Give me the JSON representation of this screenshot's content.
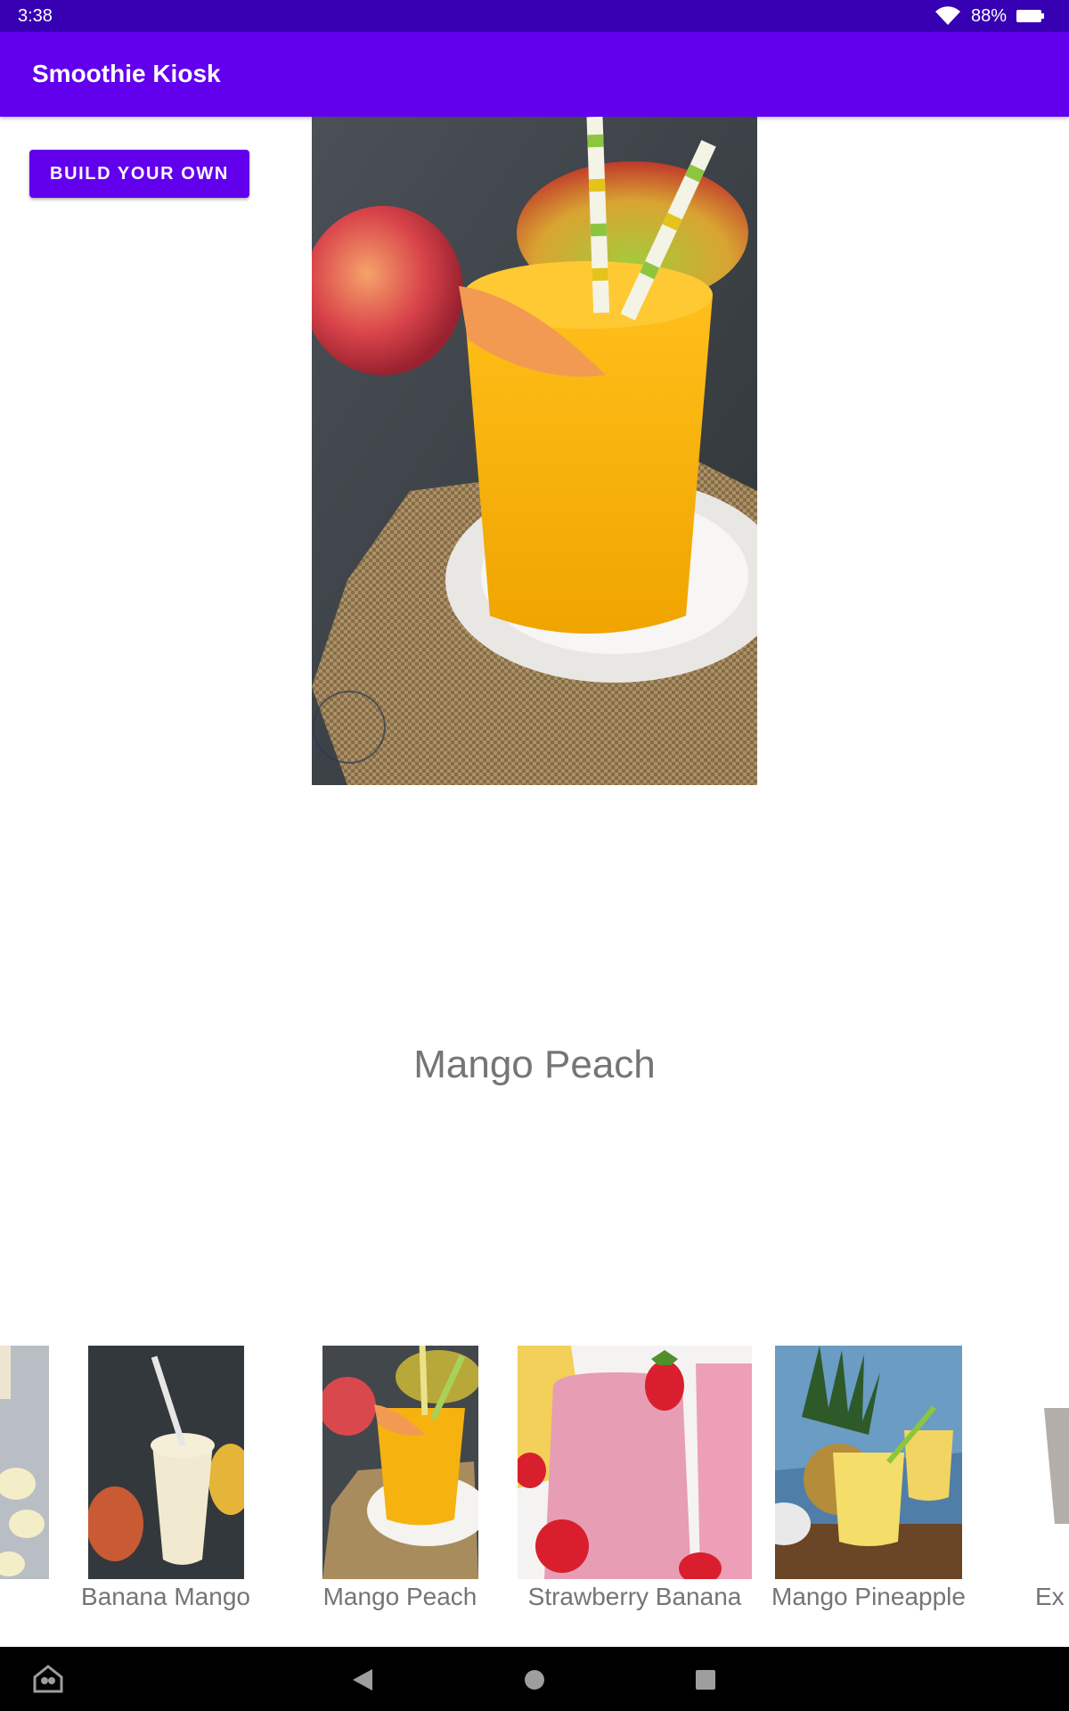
{
  "status_bar": {
    "time": "3:38",
    "battery": "88%"
  },
  "app_bar": {
    "title": "Smoothie Kiosk"
  },
  "build_button": {
    "label": "BUILD YOUR OWN"
  },
  "selected": {
    "name": "Mango Peach"
  },
  "carousel": {
    "items": [
      {
        "label": "Banana Mango"
      },
      {
        "label": "Mango Peach"
      },
      {
        "label": "Strawberry Banana"
      },
      {
        "label": "Mango Pineapple"
      },
      {
        "label": "Ex"
      }
    ]
  },
  "colors": {
    "primary": "#6200ee",
    "primary_dark": "#3700b3",
    "secondary_text": "#757575"
  },
  "icons": [
    "wifi-icon",
    "battery-icon",
    "home-assistant-icon",
    "back-icon",
    "home-icon",
    "recents-icon"
  ]
}
